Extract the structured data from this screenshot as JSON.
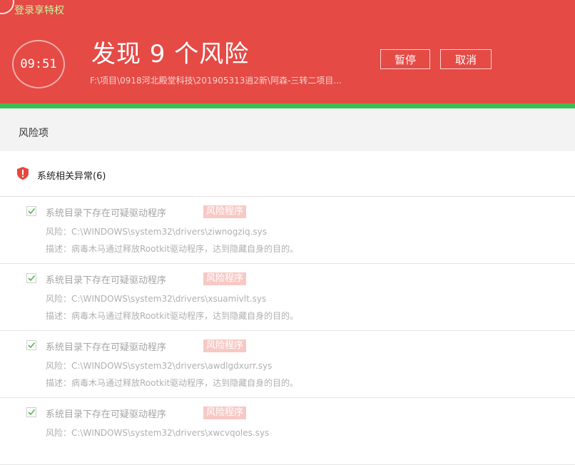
{
  "header": {
    "login_text": "登录享特权",
    "timer": "09:51",
    "title": "发现 9 个风险",
    "scan_path": "F:\\项目\\0918河北殿堂科技\\201905313逍2新\\阿森-三转二项目...",
    "pause_label": "暂停",
    "cancel_label": "取消",
    "bg_color": "#e54a45",
    "progress_color": "#3bbf4f"
  },
  "section": {
    "title": "风险项"
  },
  "category": {
    "label": "系统相关异常(6)",
    "icon": "shield-alert-icon"
  },
  "items": [
    {
      "checked": true,
      "name": "系统目录下存在可疑驱动程序",
      "tag": "风险程序",
      "risk": "风险：C:\\WINDOWS\\system32\\drivers\\ziwnogziq.sys",
      "desc": "描述：病毒木马通过释放Rootkit驱动程序，达到隐藏自身的目的。"
    },
    {
      "checked": true,
      "name": "系统目录下存在可疑驱动程序",
      "tag": "风险程序",
      "risk": "风险：C:\\WINDOWS\\system32\\drivers\\xsuamivlt.sys",
      "desc": "描述：病毒木马通过释放Rootkit驱动程序，达到隐藏自身的目的。"
    },
    {
      "checked": true,
      "name": "系统目录下存在可疑驱动程序",
      "tag": "风险程序",
      "risk": "风险：C:\\WINDOWS\\system32\\drivers\\awdlgdxurr.sys",
      "desc": "描述：病毒木马通过释放Rootkit驱动程序，达到隐藏自身的目的。"
    },
    {
      "checked": true,
      "name": "系统目录下存在可疑驱动程序",
      "tag": "风险程序",
      "risk": "风险：C:\\WINDOWS\\system32\\drivers\\xwcvqoles.sys",
      "desc": ""
    }
  ]
}
